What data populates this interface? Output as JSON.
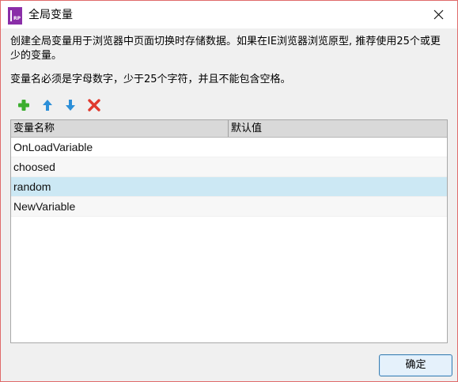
{
  "window": {
    "title": "全局变量",
    "icon_text": "RP",
    "accent": "#8a2ea8"
  },
  "description": {
    "line1": "创建全局变量用于浏览器中页面切换时存储数据。如果在IE浏览器浏览原型, 推荐使用25个或更少的变量。",
    "line2": "变量名必须是字母数字，少于25个字符，并且不能包含空格。"
  },
  "toolbar": {
    "add": "plus-icon",
    "move_up": "arrow-up-icon",
    "move_down": "arrow-down-icon",
    "delete": "delete-x-icon",
    "colors": {
      "add": "#3cae2f",
      "arrows": "#2c8fd8",
      "delete": "#e03a2e"
    }
  },
  "table": {
    "columns": [
      "变量名称",
      "默认值"
    ],
    "rows": [
      {
        "name": "OnLoadVariable",
        "default": ""
      },
      {
        "name": "choosed",
        "default": ""
      },
      {
        "name": "random",
        "default": ""
      },
      {
        "name": "NewVariable",
        "default": ""
      }
    ],
    "selected_index": 2
  },
  "buttons": {
    "ok": "确定"
  }
}
